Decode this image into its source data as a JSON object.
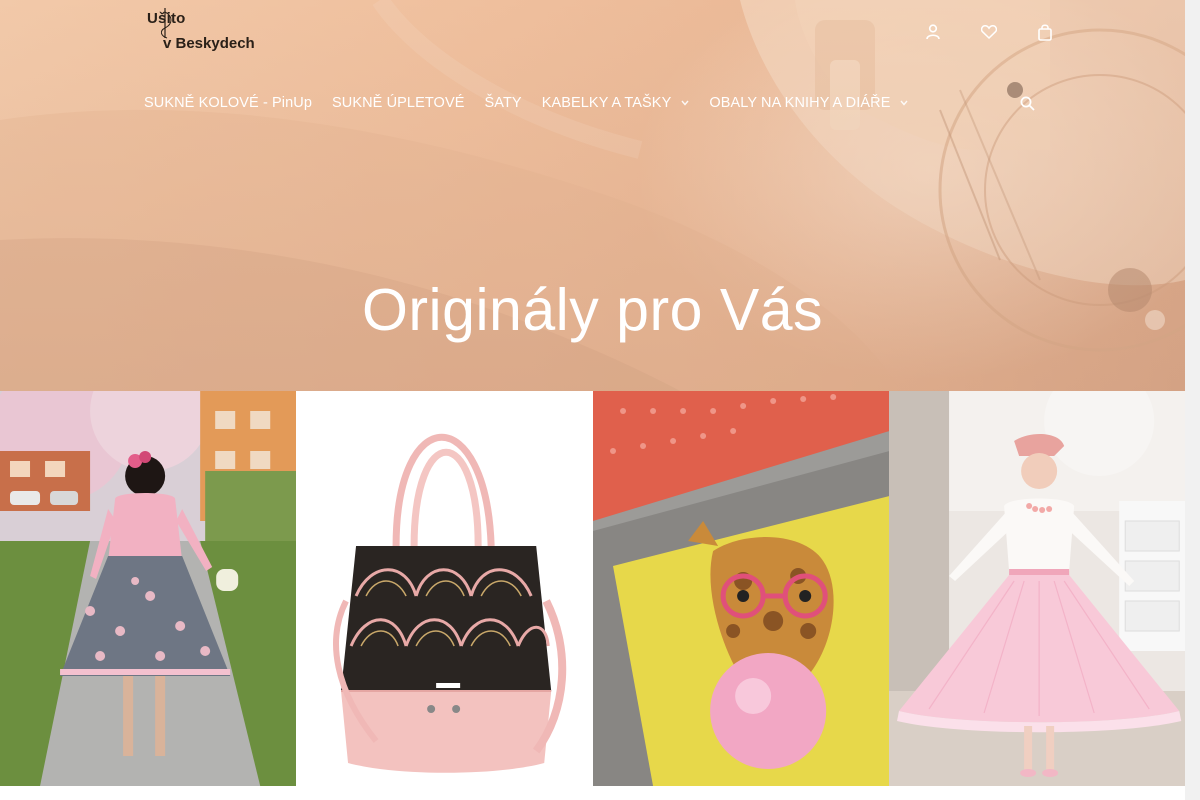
{
  "brand": {
    "logo_line1": "Ušito",
    "logo_line2": "v Beskydech"
  },
  "header_icons": [
    "user-icon",
    "heart-icon",
    "cart-icon"
  ],
  "nav": {
    "items": [
      {
        "label": "SUKNĚ KOLOVÉ - PinUp",
        "has_dropdown": false
      },
      {
        "label": "SUKNĚ ÚPLETOVÉ",
        "has_dropdown": false
      },
      {
        "label": "ŠATY",
        "has_dropdown": false
      },
      {
        "label": "KABELKY A TAŠKY",
        "has_dropdown": true
      },
      {
        "label": "OBALY NA KNIHY A DIÁŘE",
        "has_dropdown": true
      }
    ],
    "caret_glyph": "⌵"
  },
  "hero": {
    "title": "Originály pro Vás"
  },
  "tiles": [
    {
      "name": "pinup-skirt-photo"
    },
    {
      "name": "art-deco-bag-photo"
    },
    {
      "name": "giraffe-book-cover-photo"
    },
    {
      "name": "pink-circle-skirt-photo"
    }
  ],
  "colors": {
    "hero_overlay": "#efbf9d",
    "nav_text": "#ffffff",
    "accent_pink": "#f4b6c2"
  }
}
